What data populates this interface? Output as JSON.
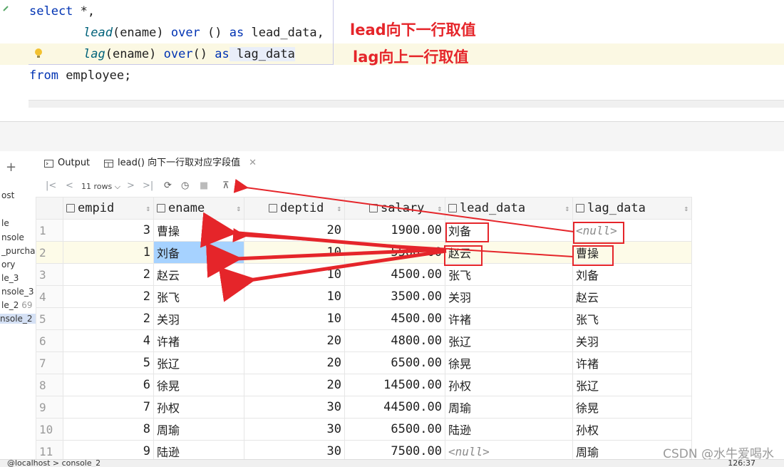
{
  "editor": {
    "line1": {
      "kw": "select",
      "rest": " *,"
    },
    "line2": {
      "fn": "lead",
      "args": "(ename) ",
      "kw1": "over",
      "rest": " () ",
      "kw2": "as",
      "alias": " lead_data,"
    },
    "line3": {
      "fn": "lag",
      "args": "(ename) ",
      "kw1": "over",
      "rest": "() ",
      "kw2": "as",
      "alias": " lag_data"
    },
    "line4": {
      "kw": "from",
      "rest": " employee;"
    }
  },
  "annotations": {
    "lead_note": "lead向下一行取值",
    "lag_note": "lag向上一行取值"
  },
  "left_panel": [
    "ost",
    "le",
    "nsole",
    "_purchas",
    "ory",
    "le_3",
    "nsole_3",
    "le_2",
    "69",
    "nsole_2"
  ],
  "tabs": {
    "output": "Output",
    "result": "lead() 向下一行取对应字段值"
  },
  "toolbar": {
    "rows": "11 rows"
  },
  "grid": {
    "columns": [
      "empid",
      "ename",
      "deptid",
      "salary",
      "lead_data",
      "lag_data"
    ],
    "null_text": "<null>",
    "rows": [
      {
        "rn": "1",
        "empid": "3",
        "ename": "曹操",
        "deptid": "20",
        "salary": "1900.00",
        "lead": "刘备",
        "lag": "<null>"
      },
      {
        "rn": "2",
        "empid": "1",
        "ename": "刘备",
        "deptid": "10",
        "salary": "5500.00",
        "lead": "赵云",
        "lag": "曹操"
      },
      {
        "rn": "3",
        "empid": "2",
        "ename": "赵云",
        "deptid": "10",
        "salary": "4500.00",
        "lead": "张飞",
        "lag": "刘备"
      },
      {
        "rn": "4",
        "empid": "2",
        "ename": "张飞",
        "deptid": "10",
        "salary": "3500.00",
        "lead": "关羽",
        "lag": "赵云"
      },
      {
        "rn": "5",
        "empid": "2",
        "ename": "关羽",
        "deptid": "10",
        "salary": "4500.00",
        "lead": "许褚",
        "lag": "张飞"
      },
      {
        "rn": "6",
        "empid": "4",
        "ename": "许褚",
        "deptid": "20",
        "salary": "4800.00",
        "lead": "张辽",
        "lag": "关羽"
      },
      {
        "rn": "7",
        "empid": "5",
        "ename": "张辽",
        "deptid": "20",
        "salary": "6500.00",
        "lead": "徐晃",
        "lag": "许褚"
      },
      {
        "rn": "8",
        "empid": "6",
        "ename": "徐晃",
        "deptid": "20",
        "salary": "14500.00",
        "lead": "孙权",
        "lag": "张辽"
      },
      {
        "rn": "9",
        "empid": "7",
        "ename": "孙权",
        "deptid": "30",
        "salary": "44500.00",
        "lead": "周瑜",
        "lag": "徐晃"
      },
      {
        "rn": "10",
        "empid": "8",
        "ename": "周瑜",
        "deptid": "30",
        "salary": "6500.00",
        "lead": "陆逊",
        "lag": "孙权"
      },
      {
        "rn": "11",
        "empid": "9",
        "ename": "陆逊",
        "deptid": "30",
        "salary": "7500.00",
        "lead": "<null>",
        "lag": "周瑜"
      }
    ]
  },
  "status": {
    "left": "@localhost  >  console_2",
    "right": "126:37"
  },
  "watermark": "CSDN @水牛爱喝水",
  "colors": {
    "annotation": "#e5252a",
    "selection": "#a6d2ff",
    "keyword": "#0033b3"
  }
}
